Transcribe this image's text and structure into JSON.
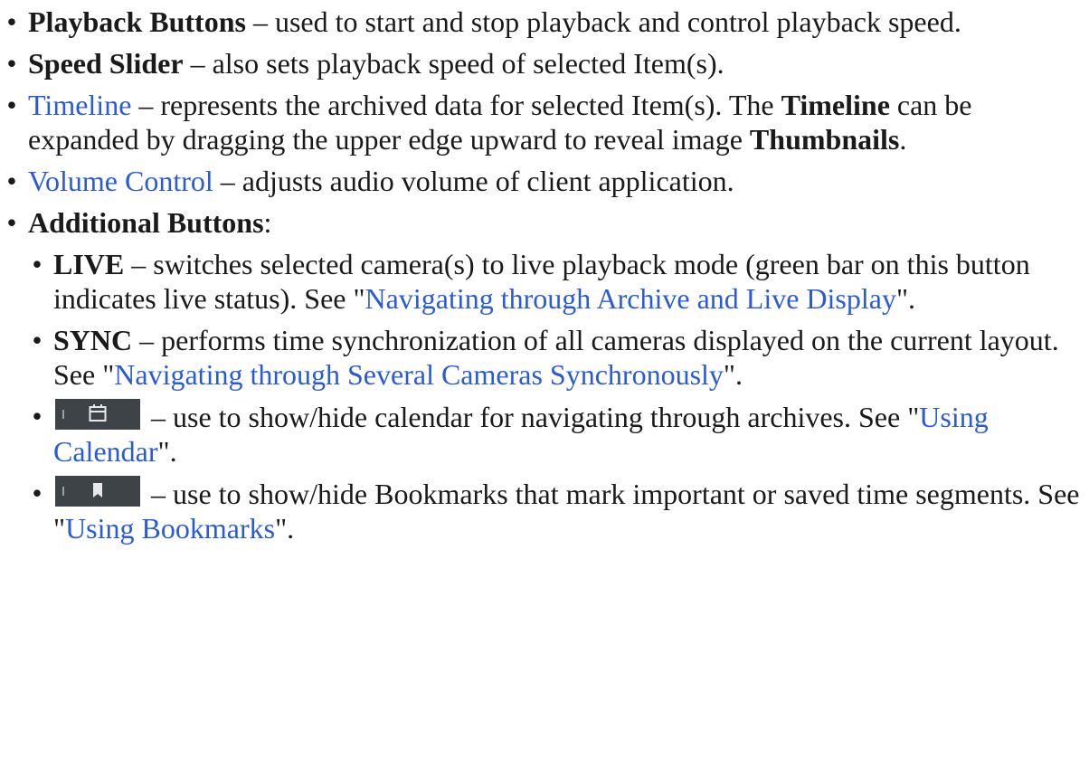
{
  "items": [
    {
      "bold": "Playback Buttons",
      "text": " – used to start and stop playback and control playback speed."
    },
    {
      "bold": "Speed Slider",
      "text": " – also sets playback speed of selected Item(s)."
    },
    {
      "link": "Timeline",
      "text1": " – represents the archived data for selected Item(s). The ",
      "bold1": "Timeline",
      "text2": " can be expanded by dragging the upper edge upward to reveal image ",
      "bold2": "Thumbnails",
      "text3": "."
    },
    {
      "link": "Volume Control",
      "text": " – adjusts audio volume of client application."
    },
    {
      "bold": "Additional Buttons",
      "text": ":"
    }
  ],
  "subitems": [
    {
      "bold": "LIVE",
      "text": " – switches selected camera(s) to live playback mode (green bar on this button indicates live status). See \"",
      "link": "Navigating through Archive and Live Display",
      "tail": "\"."
    },
    {
      "bold": "SYNC",
      "text": " – performs time synchronization of all cameras displayed on the current layout. See \"",
      "link": "Navigating through Several Cameras Synchronously",
      "tail": "\"."
    },
    {
      "icon": "calendar-icon",
      "text": " – use to show/hide calendar for navigating through archives. See \"",
      "link": "Using Calendar",
      "tail": "\"."
    },
    {
      "icon": "bookmark-icon",
      "text": " – use to show/hide Bookmarks that mark important or saved time segments. See \"",
      "link": "Using Bookmarks",
      "tail": "\"."
    }
  ],
  "colors": {
    "link": "#2a5bd7",
    "button_bg": "#3d4346",
    "icon": "#e6e8e9"
  }
}
